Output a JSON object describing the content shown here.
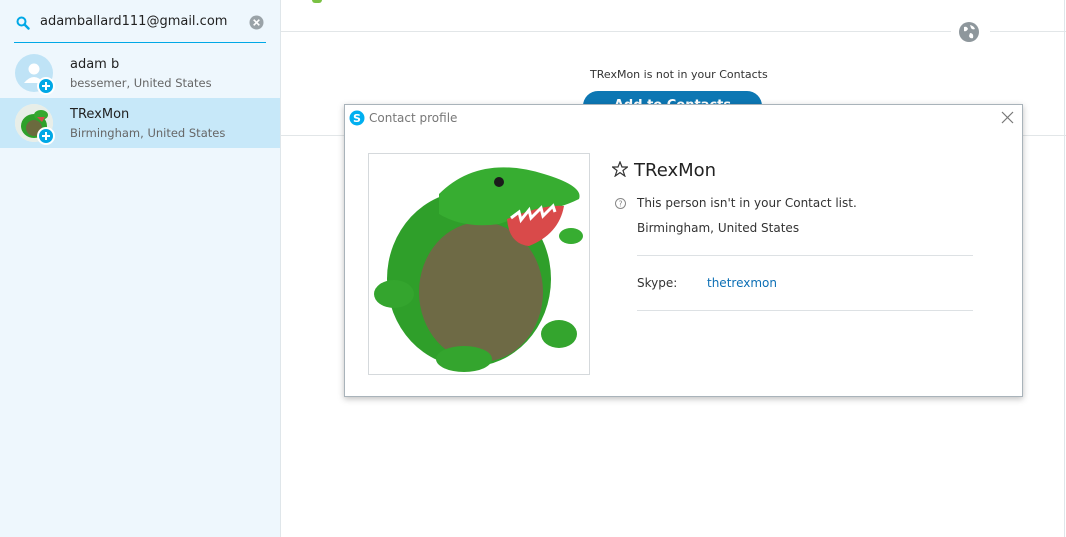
{
  "sidebar": {
    "search": {
      "value": "adamballard111@gmail.com"
    },
    "contacts": [
      {
        "name": "adam b",
        "location": "bessemer, United States",
        "avatar": "default-user-avatar",
        "selected": false
      },
      {
        "name": "TRexMon",
        "location": "Birmingham, United States",
        "avatar": "trex-avatar",
        "selected": true
      }
    ]
  },
  "main": {
    "notice": "TRexMon is not in your Contacts",
    "add_button_label": "Add to Contacts"
  },
  "dialog": {
    "title": "Contact profile",
    "profile_name": "TRexMon",
    "status_text": "This person isn't in your Contact list.",
    "location": "Birmingham, United States",
    "skype_label": "Skype:",
    "skype_id": "thetrexmon"
  },
  "colors": {
    "accent": "#00a8e6",
    "button": "#0d77b3",
    "selected_row": "#c7e8f9",
    "sidebar_bg": "#eef7fd",
    "link": "#0c6fb5"
  },
  "icons": [
    "search-icon",
    "clear-search-icon",
    "add-contact-badge-icon",
    "globe-icon",
    "skype-logo-icon",
    "close-icon",
    "star-icon",
    "help-icon"
  ]
}
